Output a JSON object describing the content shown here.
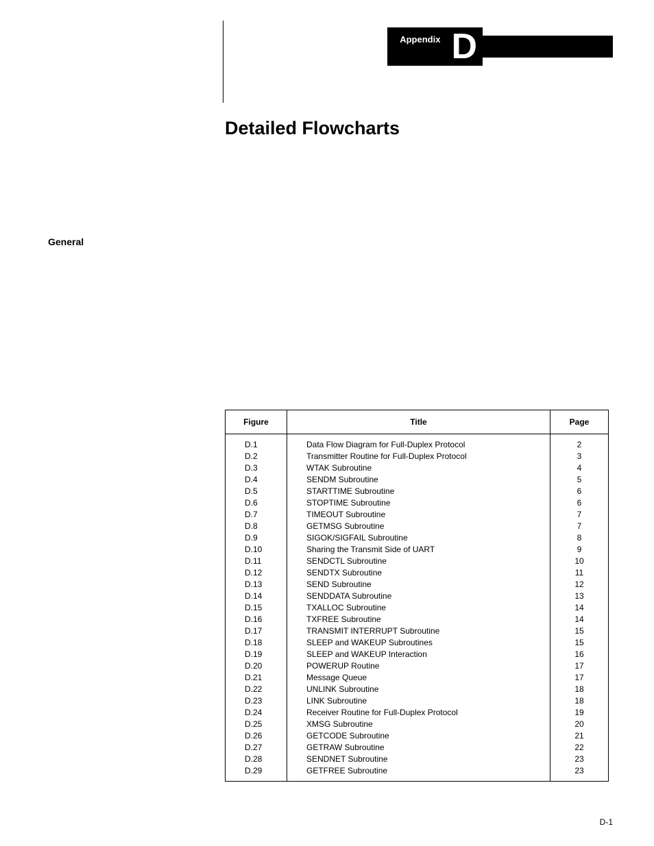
{
  "appendix": {
    "label": "Appendix",
    "letter": "D"
  },
  "title": "Detailed Flowcharts",
  "sectionLabel": "General",
  "tableHeaders": {
    "figure": "Figure",
    "title": "Title",
    "page": "Page"
  },
  "rows": [
    {
      "figure": "D.1",
      "title": "Data Flow Diagram for Full-Duplex Protocol",
      "page": "2"
    },
    {
      "figure": "D.2",
      "title": "Transmitter Routine for Full-Duplex Protocol",
      "page": "3"
    },
    {
      "figure": "D.3",
      "title": "WTAK Subroutine",
      "page": "4"
    },
    {
      "figure": "D.4",
      "title": "SENDM Subroutine",
      "page": "5"
    },
    {
      "figure": "D.5",
      "title": "STARTTIME Subroutine",
      "page": "6"
    },
    {
      "figure": "D.6",
      "title": "STOPTIME Subroutine",
      "page": "6"
    },
    {
      "figure": "D.7",
      "title": "TIMEOUT Subroutine",
      "page": "7"
    },
    {
      "figure": "D.8",
      "title": "GETMSG Subroutine",
      "page": "7"
    },
    {
      "figure": "D.9",
      "title": "SIGOK/SIGFAIL Subroutine",
      "page": "8"
    },
    {
      "figure": "D.10",
      "title": "Sharing the Transmit Side of UART",
      "page": "9"
    },
    {
      "figure": "D.11",
      "title": "SENDCTL Subroutine",
      "page": "10"
    },
    {
      "figure": "D.12",
      "title": "SENDTX Subroutine",
      "page": "11"
    },
    {
      "figure": "D.13",
      "title": "SEND Subroutine",
      "page": "12"
    },
    {
      "figure": "D.14",
      "title": "SENDDATA Subroutine",
      "page": "13"
    },
    {
      "figure": "D.15",
      "title": "TXALLOC Subroutine",
      "page": "14"
    },
    {
      "figure": "D.16",
      "title": "TXFREE Subroutine",
      "page": "14"
    },
    {
      "figure": "D.17",
      "title": "TRANSMIT INTERRUPT Subroutine",
      "page": "15"
    },
    {
      "figure": "D.18",
      "title": "SLEEP and WAKEUP Subroutines",
      "page": "15"
    },
    {
      "figure": "D.19",
      "title": "SLEEP and WAKEUP Interaction",
      "page": "16"
    },
    {
      "figure": "D.20",
      "title": "POWERUP Routine",
      "page": "17"
    },
    {
      "figure": "D.21",
      "title": "Message Queue",
      "page": "17"
    },
    {
      "figure": "D.22",
      "title": "UNLINK Subroutine",
      "page": "18"
    },
    {
      "figure": "D.23",
      "title": "LINK Subroutine",
      "page": "18"
    },
    {
      "figure": "D.24",
      "title": "Receiver Routine for Full-Duplex Protocol",
      "page": "19"
    },
    {
      "figure": "D.25",
      "title": "XMSG Subroutine",
      "page": "20"
    },
    {
      "figure": "D.26",
      "title": "GETCODE Subroutine",
      "page": "21"
    },
    {
      "figure": "D.27",
      "title": "GETRAW Subroutine",
      "page": "22"
    },
    {
      "figure": "D.28",
      "title": "SENDNET Subroutine",
      "page": "23"
    },
    {
      "figure": "D.29",
      "title": "GETFREE Subroutine",
      "page": "23"
    }
  ],
  "pageNumber": "D-1"
}
